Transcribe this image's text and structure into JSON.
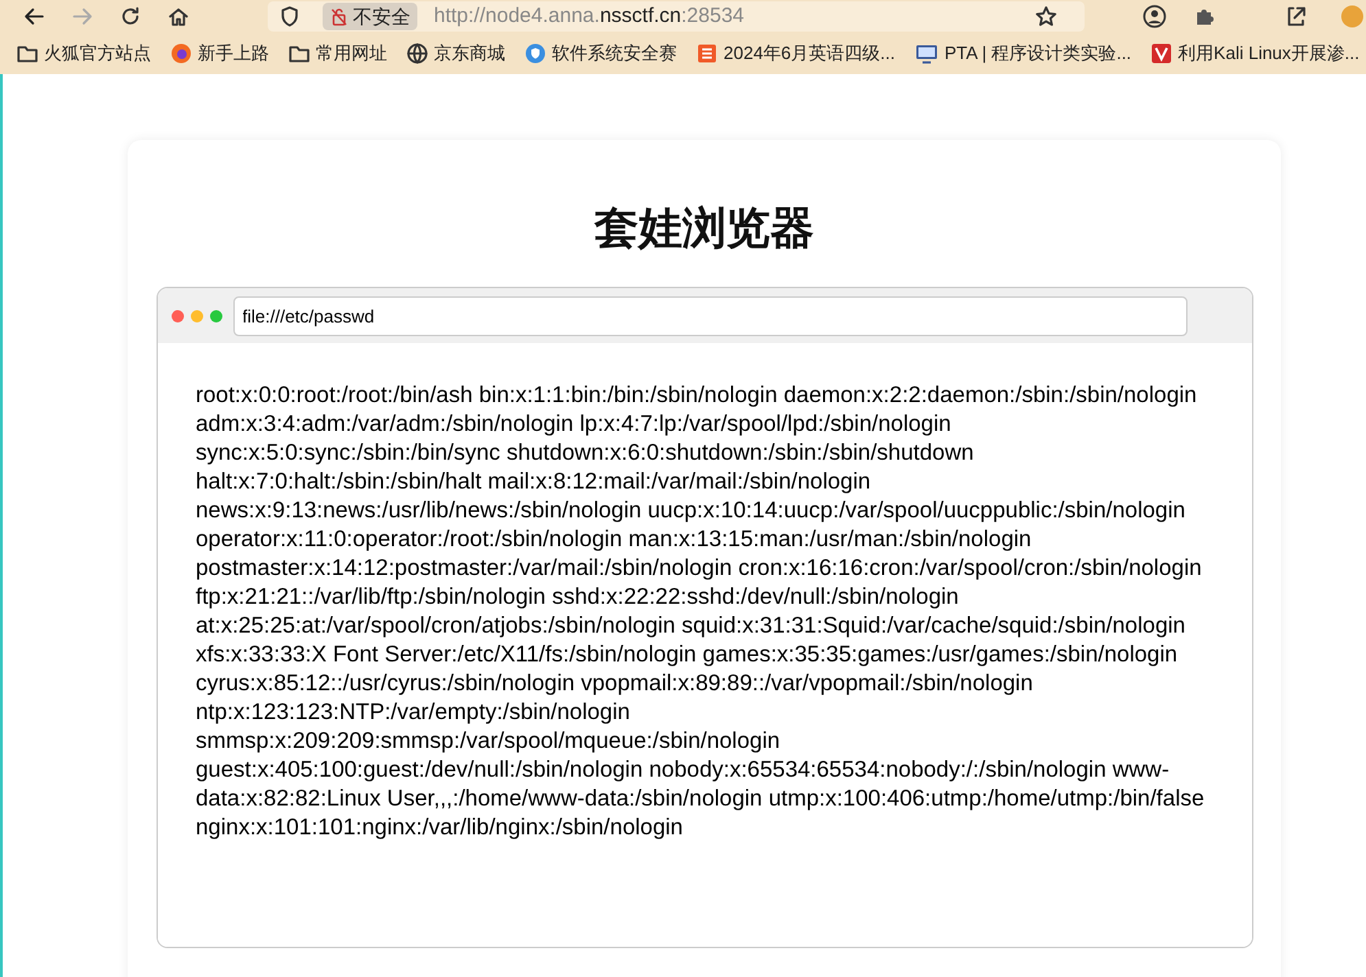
{
  "toolbar": {
    "back": {
      "disabled": false
    },
    "forward": {
      "disabled": true
    },
    "security_label": "不安全",
    "url": {
      "before": "http://node4.anna.",
      "domain": "nssctf.cn",
      "after": ":28534"
    }
  },
  "bookmarks": [
    {
      "kind": "folder",
      "label": "火狐官方站点"
    },
    {
      "kind": "firefox",
      "label": "新手上路"
    },
    {
      "kind": "folder",
      "label": "常用网址"
    },
    {
      "kind": "globe",
      "label": "京东商城"
    },
    {
      "kind": "shield",
      "label": "软件系统安全赛"
    },
    {
      "kind": "doc",
      "label": "2024年6月英语四级..."
    },
    {
      "kind": "monitor",
      "label": "PTA | 程序设计类实验..."
    },
    {
      "kind": "letter",
      "label": "利用Kali Linux开展渗..."
    }
  ],
  "page": {
    "title": "套娃浏览器",
    "inner_browser": {
      "address": "file:///etc/passwd",
      "content": "root:x:0:0:root:/root:/bin/ash bin:x:1:1:bin:/bin:/sbin/nologin daemon:x:2:2:daemon:/sbin:/sbin/nologin adm:x:3:4:adm:/var/adm:/sbin/nologin lp:x:4:7:lp:/var/spool/lpd:/sbin/nologin sync:x:5:0:sync:/sbin:/bin/sync shutdown:x:6:0:shutdown:/sbin:/sbin/shutdown halt:x:7:0:halt:/sbin:/sbin/halt mail:x:8:12:mail:/var/mail:/sbin/nologin news:x:9:13:news:/usr/lib/news:/sbin/nologin uucp:x:10:14:uucp:/var/spool/uucppublic:/sbin/nologin operator:x:11:0:operator:/root:/sbin/nologin man:x:13:15:man:/usr/man:/sbin/nologin postmaster:x:14:12:postmaster:/var/mail:/sbin/nologin cron:x:16:16:cron:/var/spool/cron:/sbin/nologin ftp:x:21:21::/var/lib/ftp:/sbin/nologin sshd:x:22:22:sshd:/dev/null:/sbin/nologin at:x:25:25:at:/var/spool/cron/atjobs:/sbin/nologin squid:x:31:31:Squid:/var/cache/squid:/sbin/nologin xfs:x:33:33:X Font Server:/etc/X11/fs:/sbin/nologin games:x:35:35:games:/usr/games:/sbin/nologin cyrus:x:85:12::/usr/cyrus:/sbin/nologin vpopmail:x:89:89::/var/vpopmail:/sbin/nologin ntp:x:123:123:NTP:/var/empty:/sbin/nologin smmsp:x:209:209:smmsp:/var/spool/mqueue:/sbin/nologin guest:x:405:100:guest:/dev/null:/sbin/nologin nobody:x:65534:65534:nobody:/:/sbin/nologin www-data:x:82:82:Linux User,,,:/home/www-data:/sbin/nologin utmp:x:100:406:utmp:/home/utmp:/bin/false nginx:x:101:101:nginx:/var/lib/nginx:/sbin/nologin"
    }
  }
}
